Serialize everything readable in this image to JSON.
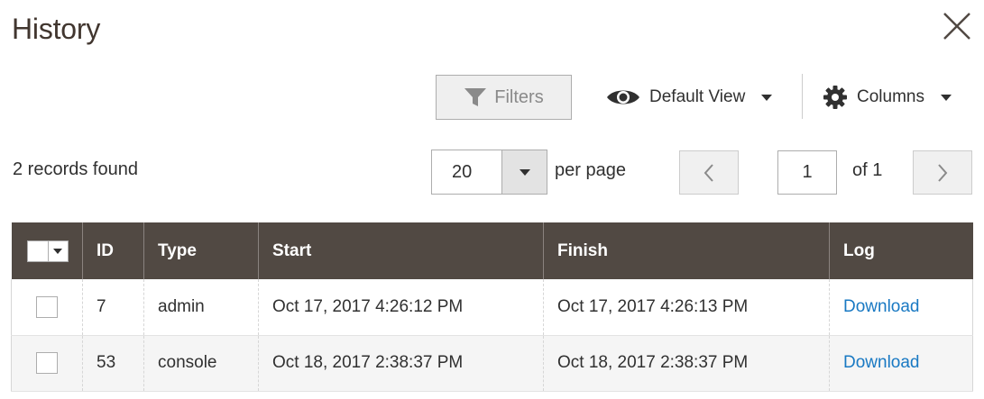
{
  "title": "History",
  "toolbar": {
    "filters_label": "Filters",
    "view_label": "Default View",
    "columns_label": "Columns"
  },
  "pager": {
    "records": "2 records found",
    "per_page_value": "20",
    "per_page_label": "per page",
    "current_page": "1",
    "of_label": "of 1"
  },
  "table": {
    "headers": [
      "ID",
      "Type",
      "Start",
      "Finish",
      "Log"
    ],
    "rows": [
      {
        "id": "7",
        "type": "admin",
        "start": "Oct 17, 2017 4:26:12 PM",
        "finish": "Oct 17, 2017 4:26:13 PM",
        "log": "Download"
      },
      {
        "id": "53",
        "type": "console",
        "start": "Oct 18, 2017 2:38:37 PM",
        "finish": "Oct 18, 2017 2:38:37 PM",
        "log": "Download"
      }
    ]
  },
  "colors": {
    "header_bg": "#514943",
    "link": "#1979c3",
    "title": "#41362f"
  },
  "icons": {
    "close": "close-icon",
    "filter": "funnel-icon",
    "view": "eye-icon",
    "columns": "gear-icon",
    "prev": "chevron-left-icon",
    "next": "chevron-right-icon"
  }
}
